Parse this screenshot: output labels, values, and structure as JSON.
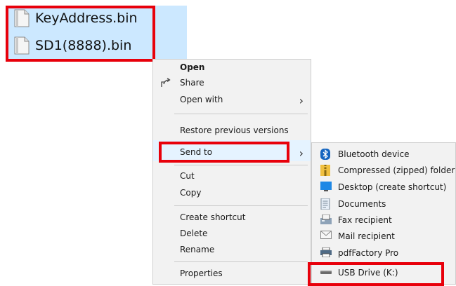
{
  "files": [
    {
      "name": "KeyAddress.bin",
      "icon": "bin-file-icon"
    },
    {
      "name": "SD1(8888).bin",
      "icon": "bin-file-icon"
    }
  ],
  "context_menu": {
    "items": [
      {
        "label": "Open",
        "bold": true
      },
      {
        "label": "Share",
        "icon": "share-icon"
      },
      {
        "label": "Open with",
        "submenu": true
      },
      {
        "label": "Restore previous versions"
      },
      {
        "label": "Send to",
        "submenu": true,
        "highlighted": true
      },
      {
        "label": "Cut"
      },
      {
        "label": "Copy"
      },
      {
        "label": "Create shortcut"
      },
      {
        "label": "Delete"
      },
      {
        "label": "Rename"
      },
      {
        "label": "Properties"
      }
    ]
  },
  "send_to_submenu": {
    "items": [
      {
        "label": "Bluetooth device",
        "icon": "bluetooth-icon"
      },
      {
        "label": "Compressed (zipped) folder",
        "icon": "zip-folder-icon"
      },
      {
        "label": "Desktop (create shortcut)",
        "icon": "desktop-icon"
      },
      {
        "label": "Documents",
        "icon": "documents-icon"
      },
      {
        "label": "Fax recipient",
        "icon": "fax-icon"
      },
      {
        "label": "Mail recipient",
        "icon": "mail-icon"
      },
      {
        "label": "pdfFactory Pro",
        "icon": "printer-icon"
      },
      {
        "label": "USB Drive (K:)",
        "icon": "usb-drive-icon"
      }
    ]
  },
  "colors": {
    "selection": "#cce8ff",
    "highlight_border": "#e8000b",
    "menu_bg": "#f2f2f2"
  }
}
